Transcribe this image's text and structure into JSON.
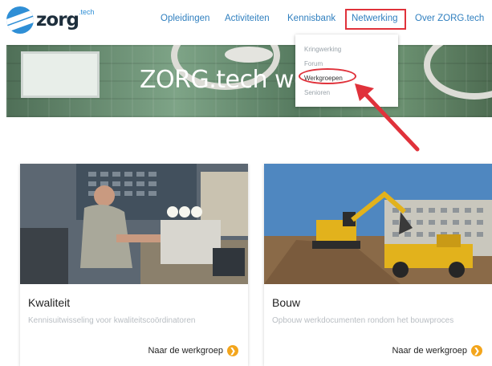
{
  "header": {
    "logo_text": "zorg",
    "logo_sup": ".tech",
    "nav": [
      {
        "label": "Opleidingen"
      },
      {
        "label": "Activiteiten"
      },
      {
        "label": "Kennisbank"
      },
      {
        "label": "Netwerking"
      },
      {
        "label": "Over ZORG.tech"
      }
    ],
    "active_nav": "Netwerking"
  },
  "hero": {
    "title": "ZORG.tech werk"
  },
  "dropdown": {
    "items": [
      {
        "label": "Kringwerking"
      },
      {
        "label": "Forum"
      },
      {
        "label": "Werkgroepen"
      },
      {
        "label": "Senioren"
      }
    ],
    "highlighted": "Werkgroepen"
  },
  "cards": [
    {
      "title": "Kwaliteit",
      "description": "Kennisuitwisseling voor kwaliteitscoördinatoren",
      "link_label": "Naar de werkgroep"
    },
    {
      "title": "Bouw",
      "description": "Opbouw werkdocumenten rondom het bouwproces",
      "link_label": "Naar de werkgroep"
    }
  ],
  "colors": {
    "accent": "#2f7fbf",
    "annotation": "#e0323b",
    "link_icon": "#f3a51c"
  }
}
